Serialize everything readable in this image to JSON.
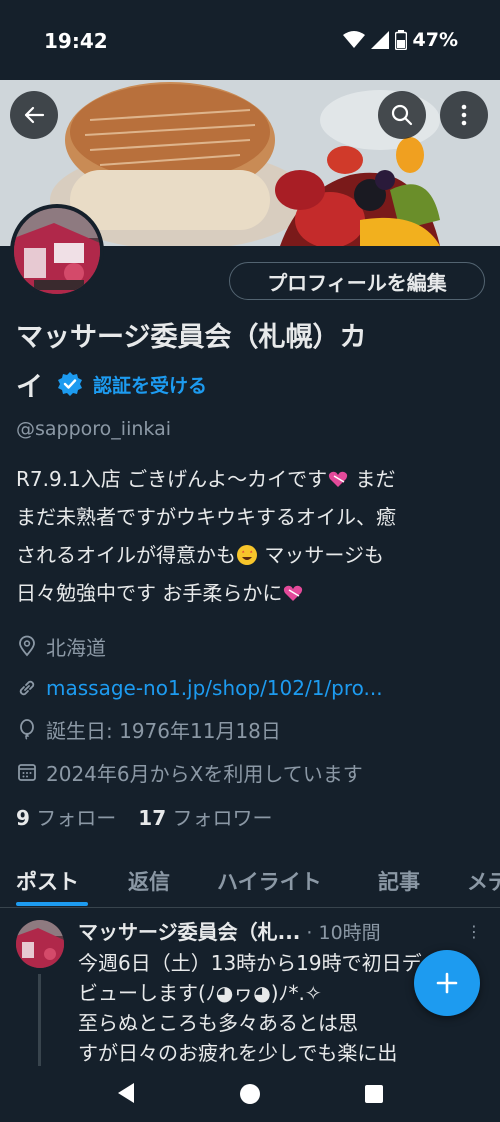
{
  "status_bar": {
    "time": "19:42",
    "battery": "47%"
  },
  "header": {
    "back_icon": "arrow-left-icon",
    "search_icon": "search-icon",
    "more_icon": "more-vertical-icon"
  },
  "profile": {
    "edit_button": "プロフィールを編集",
    "name_line1": "マッサージ委員会（札幌）カ",
    "name_line2": "イ",
    "verify_link": "認証を受ける",
    "handle": "@sapporo_iinkai",
    "bio": {
      "line1": "R7.9.1入店 ごきげんよ〜カイです",
      "line1b": " まだ",
      "line2": "まだ未熟者ですがウキウキするオイル、癒",
      "line3": "されるオイルが得意かも",
      "line3b": " マッサージも",
      "line4": "日々勉強中です お手柔らかに"
    },
    "location": "北海道",
    "website": "massage-no1.jp/shop/102/1/pro...",
    "birthday": "誕生日: 1976年11月18日",
    "joined": "2024年6月からXを利用しています",
    "following_count": "9",
    "following_label": "フォロー",
    "followers_count": "17",
    "followers_label": "フォロワー"
  },
  "tabs": [
    "ポスト",
    "返信",
    "ハイライト",
    "記事",
    "メデ"
  ],
  "post": {
    "author": "マッサージ委員会（札...",
    "time": "· 10時間",
    "body": "今週6日（土）13時から19時で初日デ\nビューします(ﾉ◕ヮ◕)ﾉ*.✧\n至らぬところも多々あるとは思\nすが日々のお疲れを少しでも楽に出"
  },
  "colors": {
    "background": "#15202b",
    "accent": "#1d9bf0",
    "muted": "#8b98a5",
    "text": "#e7e9ea"
  }
}
